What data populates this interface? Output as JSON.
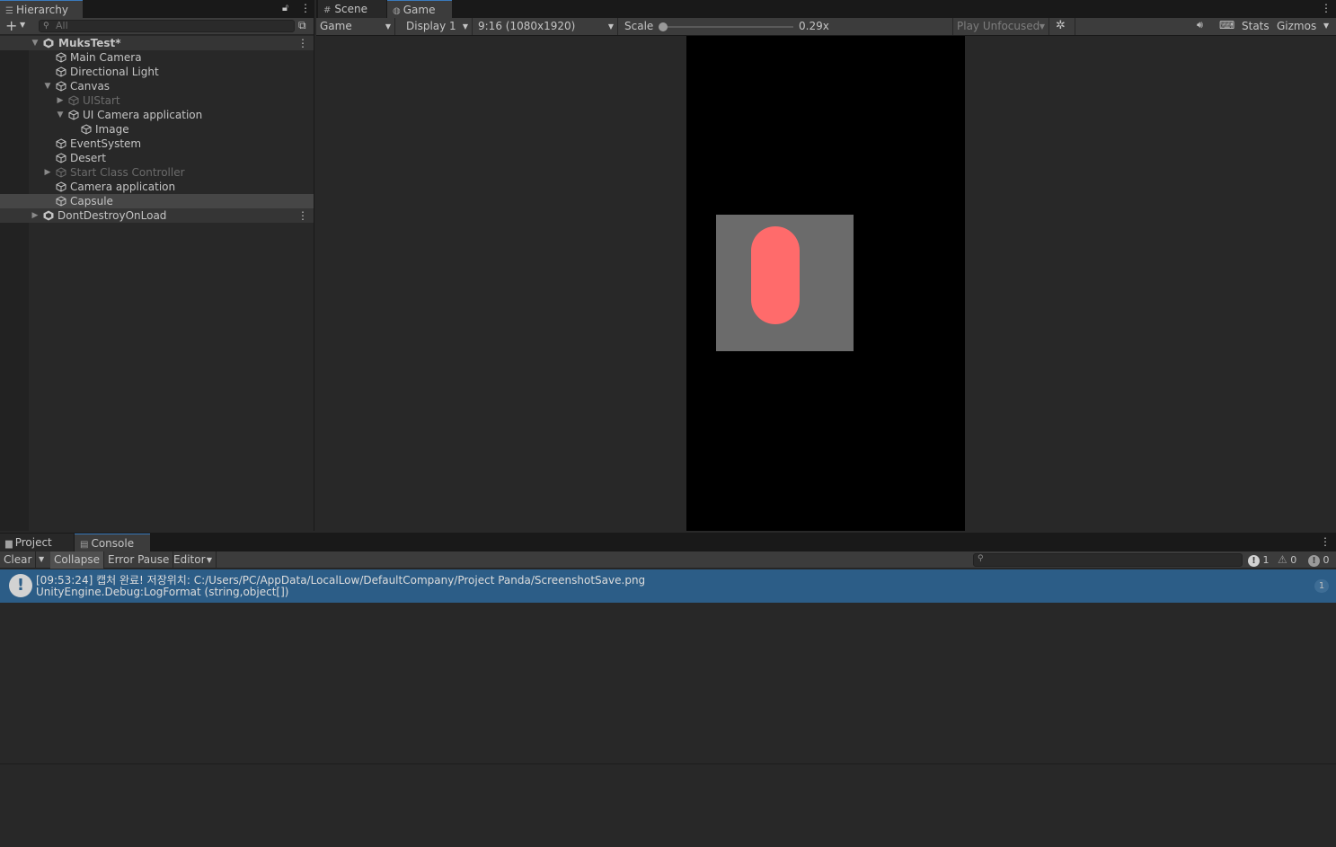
{
  "hierarchy": {
    "tab_label": "Hierarchy",
    "search_placeholder": "All",
    "items": [
      {
        "label": "MuksTest*",
        "expanded": true,
        "scene": true
      },
      {
        "label": "Main Camera"
      },
      {
        "label": "Directional Light"
      },
      {
        "label": "Canvas",
        "expanded": true
      },
      {
        "label": "UIStart",
        "collapsed": true,
        "inactive": true
      },
      {
        "label": "UI Camera application",
        "expanded": true
      },
      {
        "label": "Image"
      },
      {
        "label": "EventSystem"
      },
      {
        "label": "Desert"
      },
      {
        "label": "Start Class Controller",
        "collapsed": true,
        "inactive": true
      },
      {
        "label": "Camera application"
      },
      {
        "label": "Capsule",
        "selected": true
      },
      {
        "label": "DontDestroyOnLoad",
        "collapsed": true,
        "scene": true
      }
    ]
  },
  "game_view": {
    "tabs": [
      {
        "label": "Scene",
        "icon": "grid-icon"
      },
      {
        "label": "Game",
        "icon": "gamepad-icon",
        "active": true
      }
    ],
    "toolbar": {
      "mode": "Game",
      "display": "Display 1",
      "resolution": "9:16 (1080x1920)",
      "scale_label": "Scale",
      "scale_value": "0.29x",
      "play_mode": "Play Unfocused",
      "stats": "Stats",
      "gizmos": "Gizmos"
    },
    "colors": {
      "capsule": "#ff6b6b",
      "image_bg": "#6b6b6b"
    }
  },
  "console": {
    "tabs": [
      {
        "label": "Project",
        "icon": "folder-icon"
      },
      {
        "label": "Console",
        "icon": "console-icon",
        "active": true
      }
    ],
    "toolbar": {
      "clear": "Clear",
      "collapse": "Collapse",
      "error_pause": "Error Pause",
      "editor": "Editor",
      "info_count": "1",
      "warning_count": "0",
      "error_count": "0"
    },
    "entries": [
      {
        "line1": "[09:53:24] 캡처 완료! 저장위치: C:/Users/PC/AppData/LocalLow/DefaultCompany/Project Panda/ScreenshotSave.png",
        "line2": "UnityEngine.Debug:LogFormat (string,object[])",
        "count": "1"
      }
    ]
  }
}
